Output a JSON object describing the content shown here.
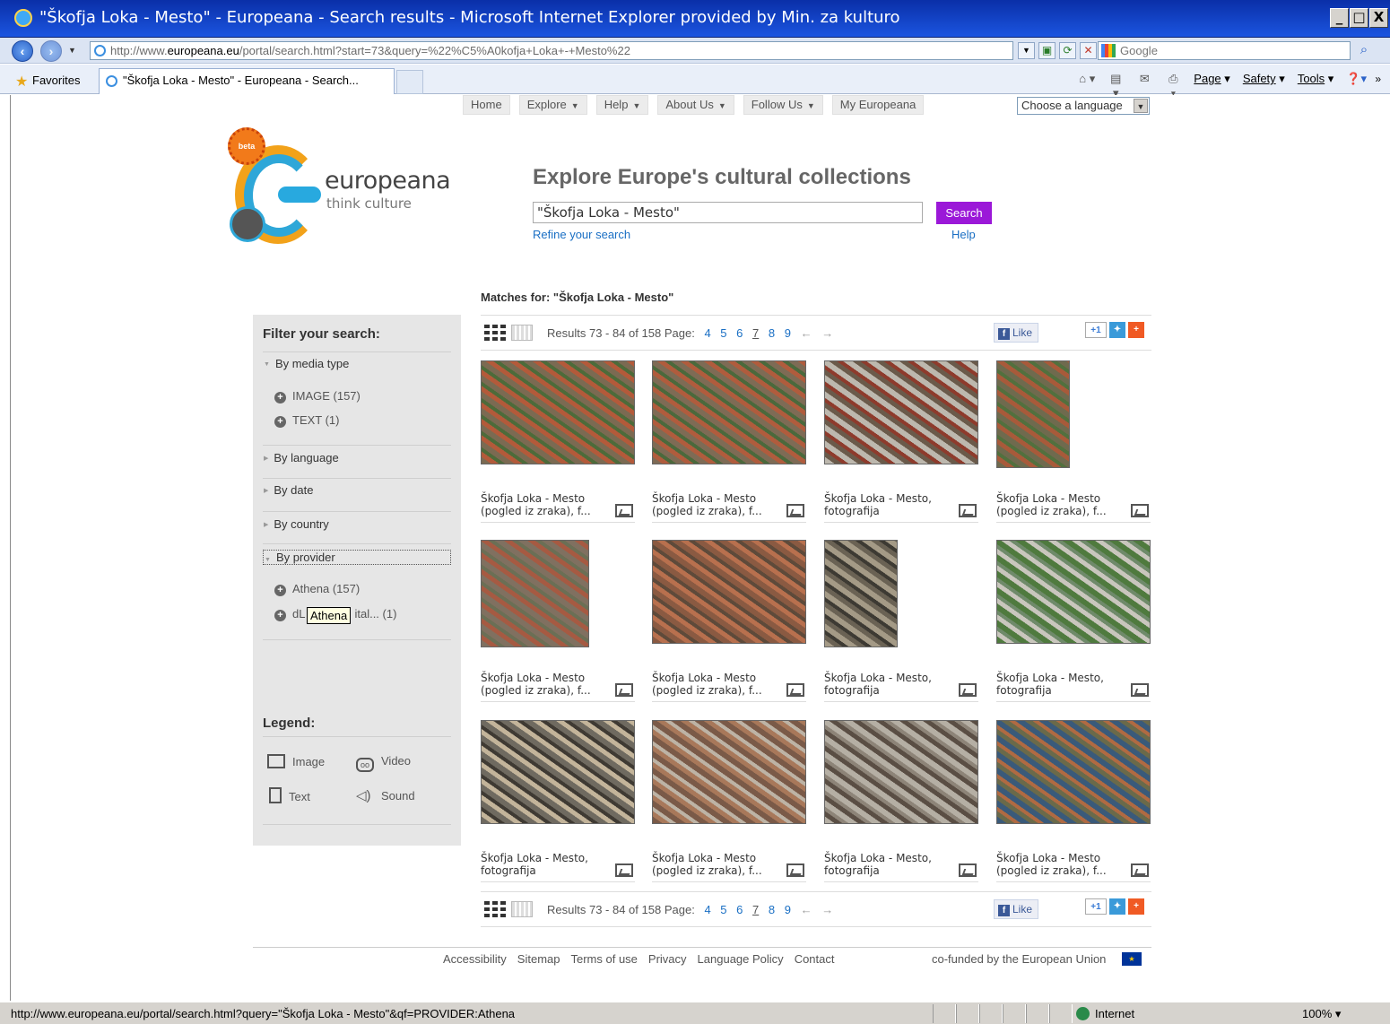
{
  "window": {
    "title": "\"Škofja Loka - Mesto\" - Europeana - Search results - Microsoft Internet Explorer provided by Min. za kulturo",
    "buttons": [
      "_",
      "□",
      "X"
    ]
  },
  "addressbar": {
    "url_prefix": "http://www.",
    "url_domain": "europeana.eu",
    "url_rest": "/portal/search.html?start=73&query=%22%C5%A0kofja+Loka+-+Mesto%22",
    "search_placeholder": "Google"
  },
  "favbar": {
    "favorites_label": "Favorites",
    "tab_title": "\"Škofja Loka - Mesto\" - Europeana - Search...",
    "commands": [
      "Page",
      "Safety",
      "Tools"
    ]
  },
  "topnav": {
    "items": [
      {
        "label": "Home",
        "has_caret": false
      },
      {
        "label": "Explore",
        "has_caret": true
      },
      {
        "label": "Help",
        "has_caret": true
      },
      {
        "label": "About Us",
        "has_caret": true
      },
      {
        "label": "Follow Us",
        "has_caret": true
      },
      {
        "label": "My Europeana",
        "has_caret": false
      }
    ],
    "language_select": "Choose a language"
  },
  "logo": {
    "beta": "beta",
    "name": "europeana",
    "tagline": "think culture"
  },
  "search": {
    "heading": "Explore Europe's cultural collections",
    "query": "\"Škofja Loka - Mesto\"",
    "button": "Search",
    "refine_link": "Refine your search",
    "help_link": "Help"
  },
  "matches": {
    "label": "Matches for:",
    "query": "\"Škofja Loka - Mesto\""
  },
  "sidebar": {
    "title": "Filter your search:",
    "media_type": {
      "label": "By media type",
      "items": [
        "IMAGE (157)",
        "TEXT (1)"
      ]
    },
    "language": "By language",
    "date": "By date",
    "country": "By country",
    "provider": {
      "label": "By provider",
      "items": [
        "Athena (157)",
        "dL",
        "ital... (1)"
      ]
    },
    "tooltip": "Athena",
    "legend": {
      "title": "Legend:",
      "image": "Image",
      "video": "Video",
      "text": "Text",
      "sound": "Sound"
    }
  },
  "results": {
    "summary": "Results 73 - 84 of 158",
    "page_label": "Page:",
    "pages": [
      "4",
      "5",
      "6",
      "7",
      "8",
      "9"
    ],
    "current_page": "7",
    "prev": "←",
    "next": "→",
    "like": "Like",
    "items": [
      {
        "title": "Škofja Loka - Mesto (pogled iz zraka), f...",
        "palette": [
          "#7b6a52",
          "#b35a3a",
          "#4d6b3a"
        ]
      },
      {
        "title": "Škofja Loka - Mesto (pogled iz zraka), f...",
        "palette": [
          "#7e6b55",
          "#b05c3d",
          "#4b693c"
        ]
      },
      {
        "title": "Škofja Loka - Mesto, fotografija",
        "palette": [
          "#bdb8ae",
          "#6a5a4a",
          "#8e3b2c"
        ]
      },
      {
        "title": "Škofja Loka - Mesto (pogled iz zraka), f...",
        "palette": [
          "#6f6a4e",
          "#a85a3a",
          "#52703e"
        ]
      },
      {
        "title": "Škofja Loka - Mesto (pogled iz zraka), f...",
        "palette": [
          "#807060",
          "#a65a42",
          "#6b6f55"
        ]
      },
      {
        "title": "Škofja Loka - Mesto (pogled iz zraka), f...",
        "palette": [
          "#8a5a42",
          "#b8704e",
          "#5e4a3a"
        ]
      },
      {
        "title": "Škofja Loka - Mesto, fotografija",
        "palette": [
          "#a49a86",
          "#6a6254",
          "#3d3a33"
        ]
      },
      {
        "title": "Škofja Loka - Mesto, fotografija",
        "palette": [
          "#4f7a3e",
          "#c9c6bd",
          "#6f8a6a"
        ]
      },
      {
        "title": "Škofja Loka - Mesto, fotografija",
        "palette": [
          "#6f6a60",
          "#c3b49a",
          "#3f3a33"
        ]
      },
      {
        "title": "Škofja Loka - Mesto (pogled iz zraka), f...",
        "palette": [
          "#7a5a48",
          "#a8785a",
          "#bdb3a5"
        ]
      },
      {
        "title": "Škofja Loka - Mesto, fotografija",
        "palette": [
          "#b5afa4",
          "#5a4e44",
          "#8d8478"
        ]
      },
      {
        "title": "Škofja Loka - Mesto (pogled iz zraka), f...",
        "palette": [
          "#3a5a7a",
          "#6a6a4a",
          "#b06a42"
        ]
      }
    ]
  },
  "footer": {
    "links": [
      "Accessibility",
      "Sitemap",
      "Terms of use",
      "Privacy",
      "Language Policy",
      "Contact"
    ],
    "eu_text": "co-funded by the European Union"
  },
  "statusbar": {
    "url": "http://www.europeana.eu/portal/search.html?query=\"Škofja Loka - Mesto\"&qf=PROVIDER:Athena",
    "zone": "Internet",
    "zoom": "100%"
  }
}
